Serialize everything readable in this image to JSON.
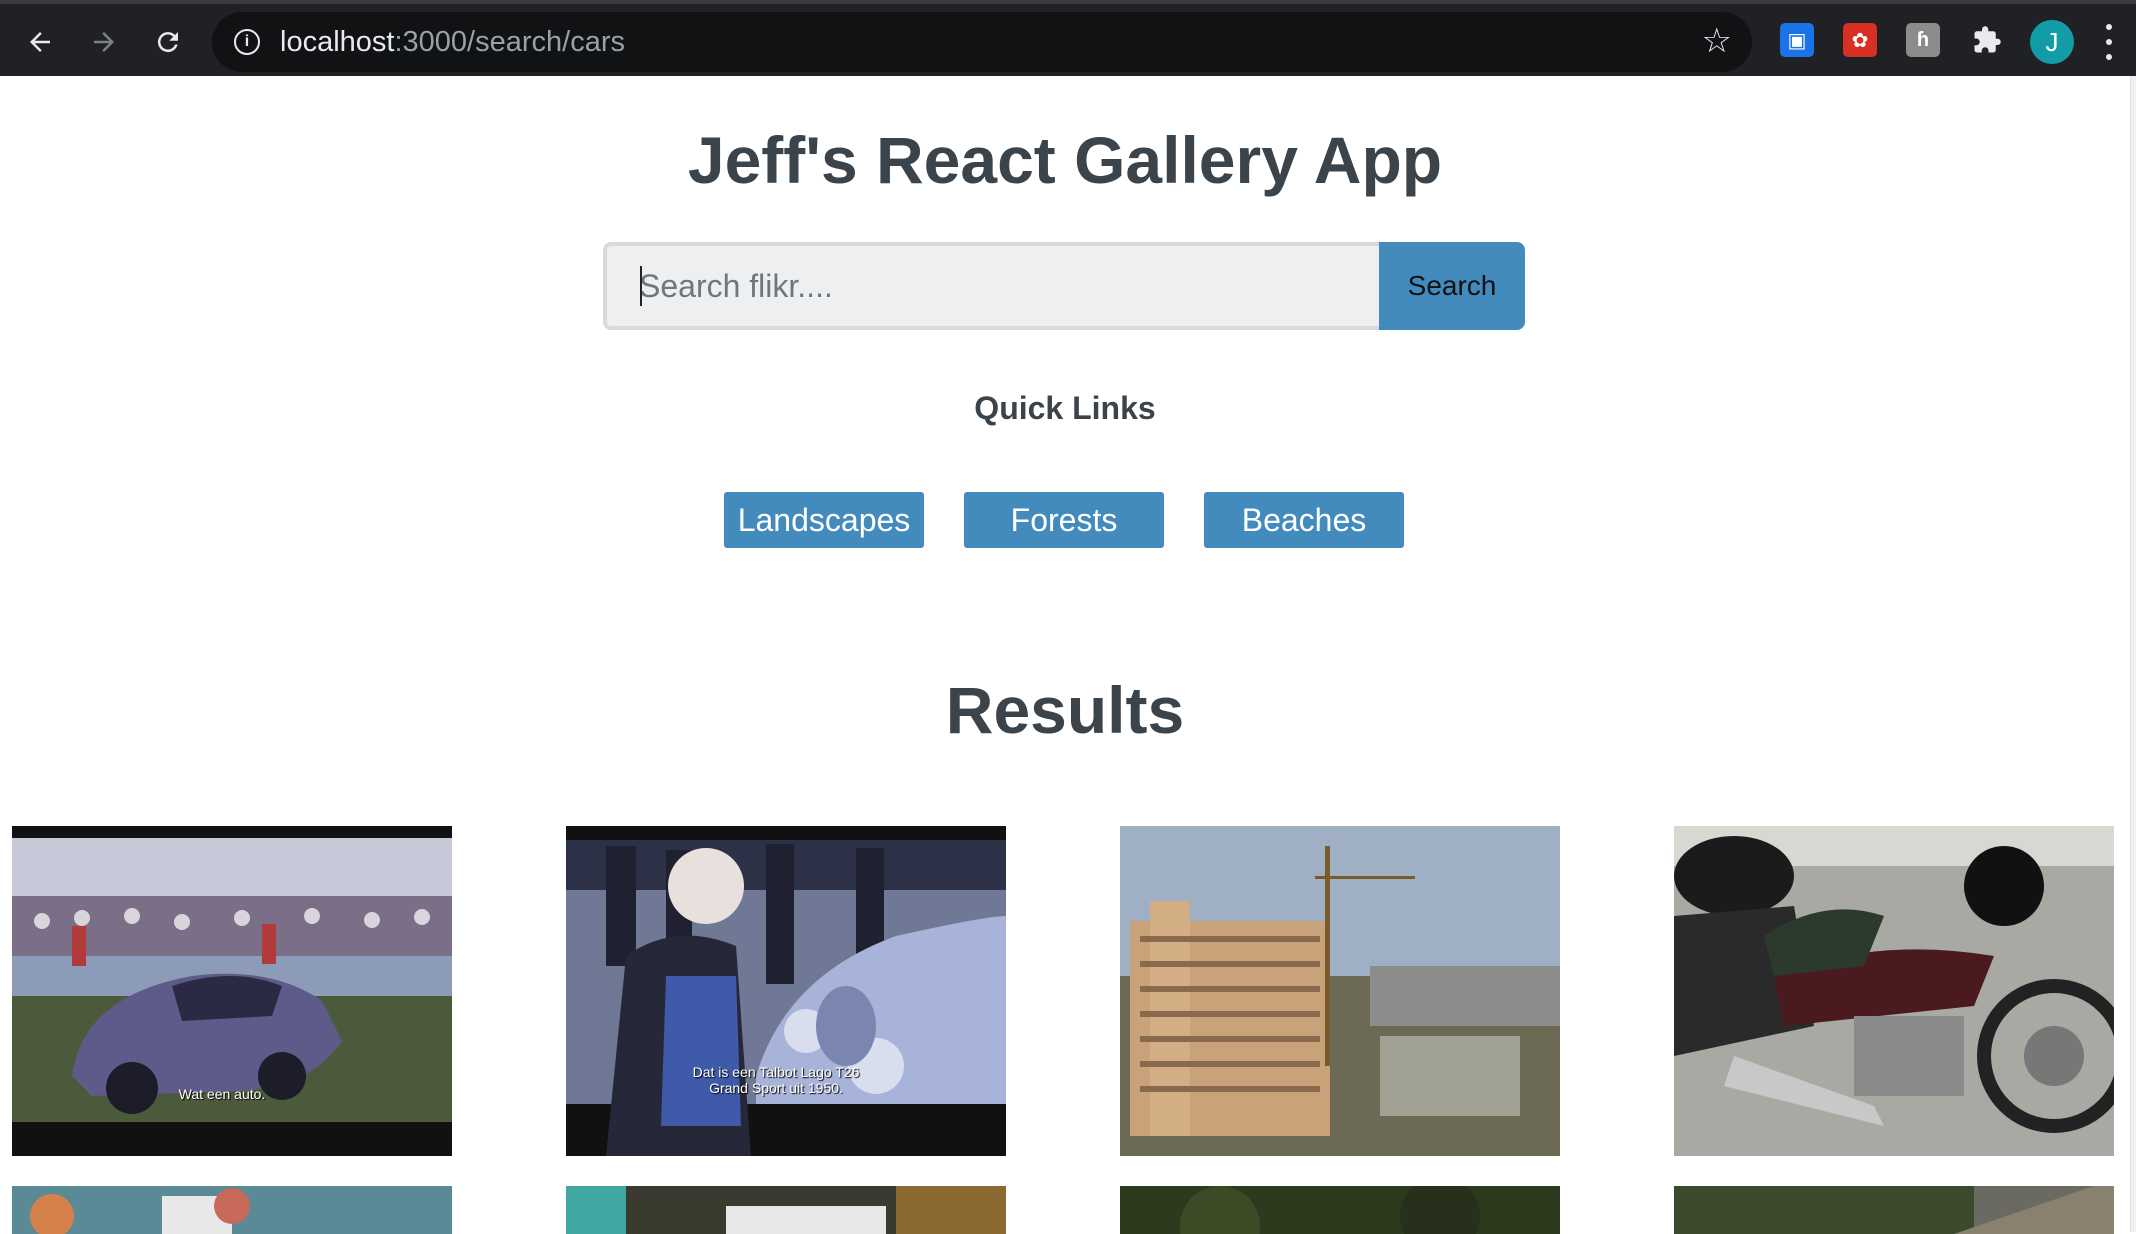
{
  "browser": {
    "url_host": "localhost",
    "url_path": ":3000/search/cars",
    "avatar_letter": "J",
    "icons": [
      "back-icon",
      "forward-icon",
      "reload-icon",
      "info-icon",
      "star-icon",
      "extension-icon",
      "avatar",
      "menu-icon"
    ]
  },
  "app": {
    "title": "Jeff's React Gallery App",
    "search": {
      "placeholder": "Search flikr....",
      "value": "",
      "button_label": "Search"
    },
    "quick_links": {
      "heading": "Quick Links",
      "items": [
        {
          "label": "Landscapes"
        },
        {
          "label": "Forests"
        },
        {
          "label": "Beaches"
        }
      ]
    },
    "results_heading": "Results",
    "photos": [
      {
        "caption": "Wat een auto."
      },
      {
        "caption_line1": "Dat is een Talbot Lago T26",
        "caption_line2": "Grand Sport uit 1950."
      }
    ]
  },
  "colors": {
    "accent": "#438bbd",
    "text": "#3b434b",
    "chrome": "#202124"
  }
}
